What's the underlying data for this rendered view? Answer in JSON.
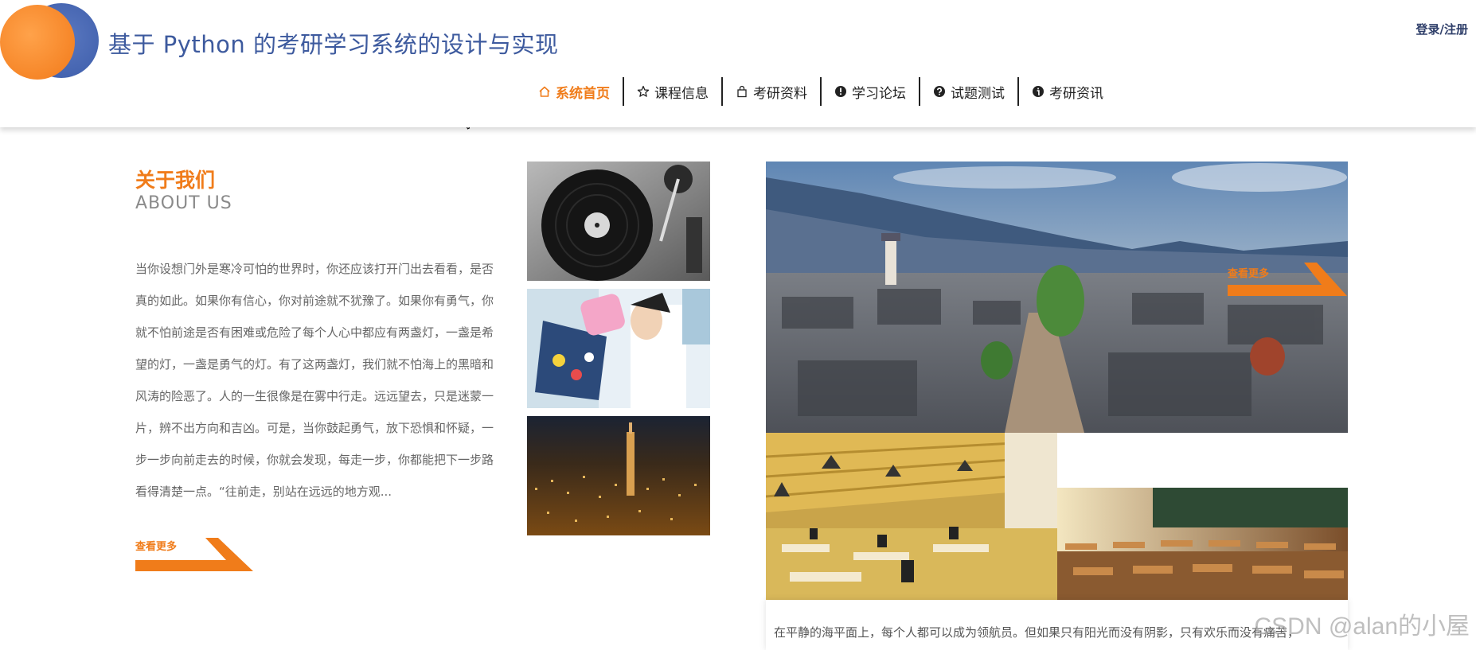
{
  "header": {
    "site_title": "基于 Python 的考研学习系统的设计与实现",
    "login_label": "登录/注册",
    "nav": [
      {
        "label": "系统首页",
        "icon": "home-icon",
        "active": true
      },
      {
        "label": "课程信息",
        "icon": "star-icon",
        "active": false
      },
      {
        "label": "考研资料",
        "icon": "bag-icon",
        "active": false
      },
      {
        "label": "学习论坛",
        "icon": "alert-circle-icon",
        "active": false
      },
      {
        "label": "试题测试",
        "icon": "question-circle-icon",
        "active": false
      },
      {
        "label": "考研资讯",
        "icon": "info-circle-icon",
        "active": false
      }
    ]
  },
  "about": {
    "title": "关于我们",
    "subtitle": "ABOUT US",
    "text": "当你设想门外是寒冷可怕的世界时，你还应该打开门出去看看，是否真的如此。如果你有信心，你对前途就不犹豫了。如果你有勇气，你就不怕前途是否有困难或危险了每个人心中都应有两盏灯，一盏是希望的灯，一盏是勇气的灯。有了这两盏灯，我们就不怕海上的黑暗和风涛的险恶了。人的一生很像是在雾中行走。远远望去，只是迷蒙一片，辨不出方向和吉凶。可是，当你鼓起勇气，放下恐惧和怀疑，一步一步向前走去的时候，你就会发现，每走一步，你都能把下一步路看得清楚一点。“往前走，别站在远远的地方观...",
    "more_label": "查看更多"
  },
  "gallery": {
    "more_label": "查看更多",
    "bottom_text": "在平静的海平面上，每个人都可以成为领航员。但如果只有阳光而没有阴影，只有欢乐而没有痛苦，"
  },
  "watermark": "CSDN @alan的小屋",
  "colors": {
    "accent": "#f07c1a",
    "title_blue": "#3d5a9e"
  }
}
